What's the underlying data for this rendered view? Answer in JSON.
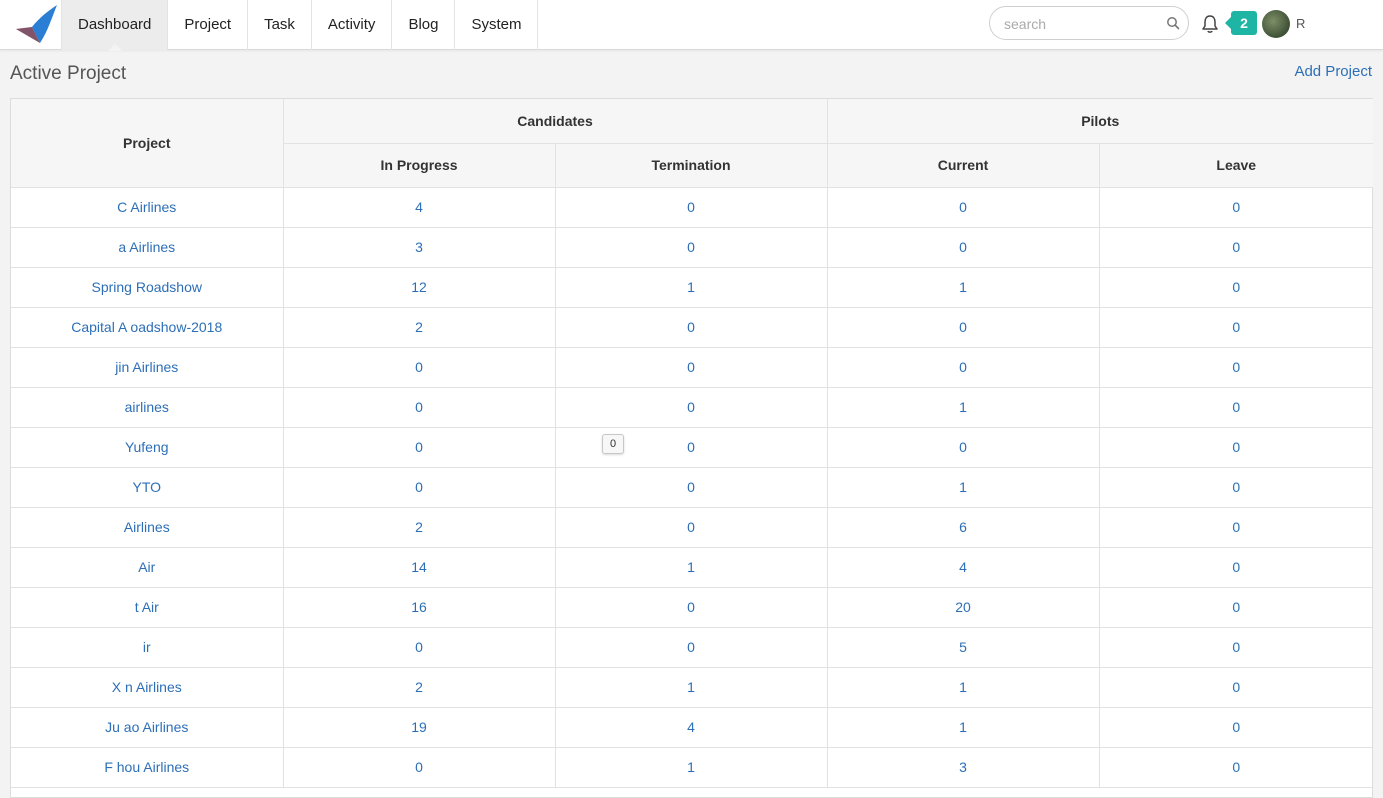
{
  "nav": {
    "items": [
      "Dashboard",
      "Project",
      "Task",
      "Activity",
      "Blog",
      "System"
    ],
    "active": "Dashboard"
  },
  "search": {
    "placeholder": "search",
    "value": ""
  },
  "notifications": {
    "count": "2"
  },
  "user": {
    "name_visible": "R"
  },
  "page": {
    "title": "Active Project",
    "add_project_label": "Add Project"
  },
  "table": {
    "project_header": "Project",
    "group_headers": [
      "Candidates",
      "Pilots"
    ],
    "sub_headers": [
      "In Progress",
      "Termination",
      "Current",
      "Leave"
    ],
    "rows": [
      {
        "project": "C Airlines",
        "in_progress": "4",
        "termination": "0",
        "current": "0",
        "leave": "0"
      },
      {
        "project": "a Airlines",
        "in_progress": "3",
        "termination": "0",
        "current": "0",
        "leave": "0"
      },
      {
        "project": "Spring Roadshow",
        "in_progress": "12",
        "termination": "1",
        "current": "1",
        "leave": "0"
      },
      {
        "project": "Capital A oadshow-2018",
        "in_progress": "2",
        "termination": "0",
        "current": "0",
        "leave": "0"
      },
      {
        "project": "jin Airlines",
        "in_progress": "0",
        "termination": "0",
        "current": "0",
        "leave": "0"
      },
      {
        "project": "airlines",
        "in_progress": "0",
        "termination": "0",
        "current": "1",
        "leave": "0"
      },
      {
        "project": "Yufeng",
        "in_progress": "0",
        "termination": "0",
        "current": "0",
        "leave": "0"
      },
      {
        "project": "YTO",
        "in_progress": "0",
        "termination": "0",
        "current": "1",
        "leave": "0"
      },
      {
        "project": "Airlines",
        "in_progress": "2",
        "termination": "0",
        "current": "6",
        "leave": "0"
      },
      {
        "project": "Air",
        "in_progress": "14",
        "termination": "1",
        "current": "4",
        "leave": "0"
      },
      {
        "project": "t Air",
        "in_progress": "16",
        "termination": "0",
        "current": "20",
        "leave": "0"
      },
      {
        "project": "ir",
        "in_progress": "0",
        "termination": "0",
        "current": "5",
        "leave": "0"
      },
      {
        "project": "X n Airlines",
        "in_progress": "2",
        "termination": "1",
        "current": "1",
        "leave": "0"
      },
      {
        "project": "Ju ao Airlines",
        "in_progress": "19",
        "termination": "4",
        "current": "1",
        "leave": "0"
      },
      {
        "project": "F hou Airlines",
        "in_progress": "0",
        "termination": "1",
        "current": "3",
        "leave": "0"
      }
    ]
  },
  "tooltip": {
    "text": "0"
  },
  "colors": {
    "link": "#2d6fb7",
    "badge": "#1fb5a5",
    "logo_blue": "#2a7fd4",
    "logo_red": "#e2492d"
  }
}
